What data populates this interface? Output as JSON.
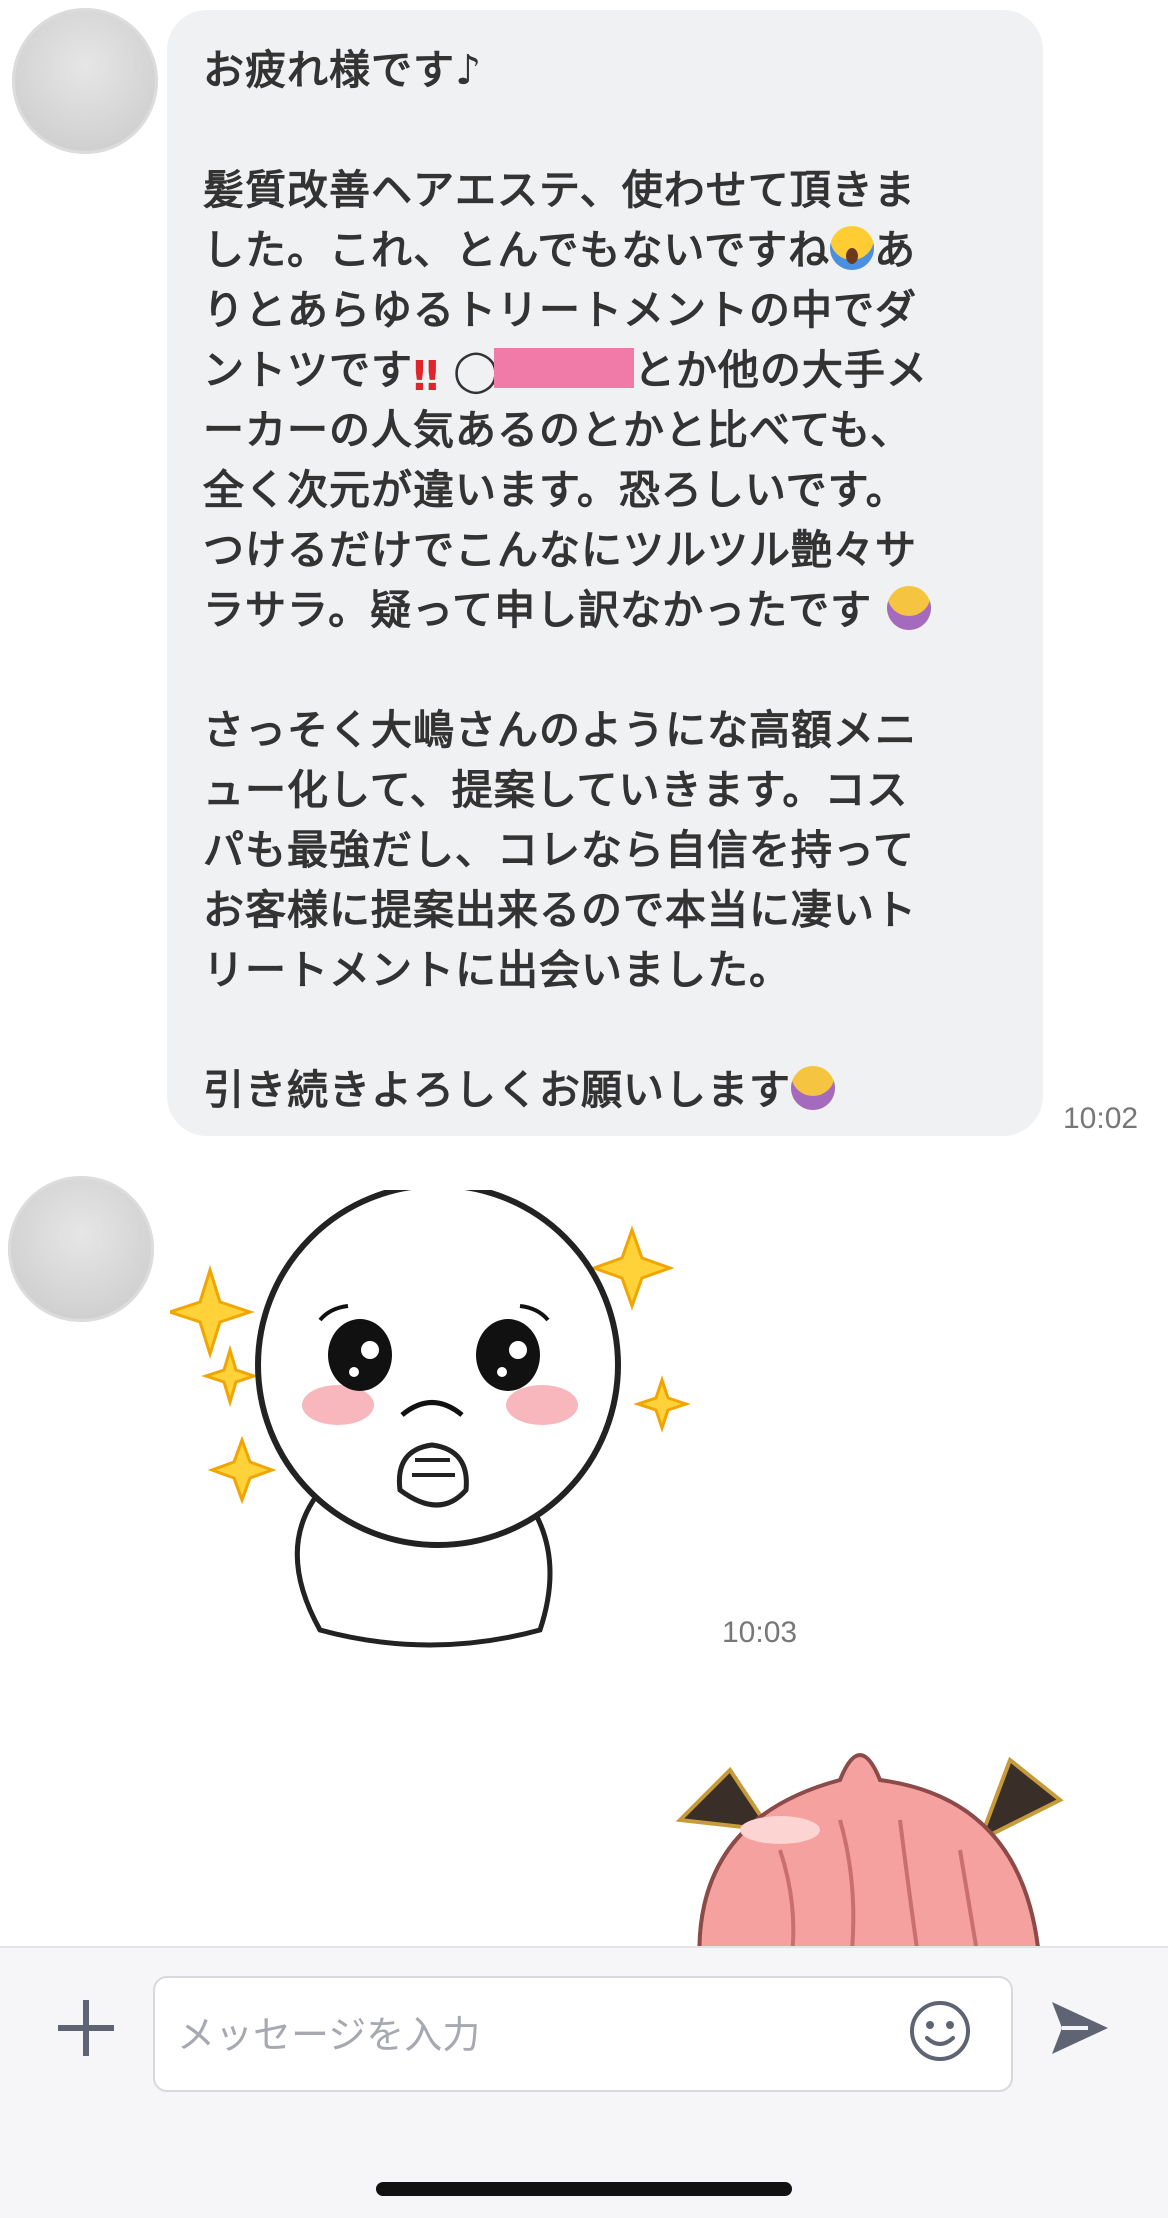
{
  "messages": [
    {
      "lines": [
        {
          "segments": [
            "お疲れ様です♪"
          ]
        },
        {
          "segments": [
            ""
          ]
        },
        {
          "segments": [
            "髪質改善ヘアエステ、使わせて頂きま"
          ]
        },
        {
          "segments": [
            "した。これ、とんでもないですね",
            "あ"
          ]
        },
        {
          "segments": [
            "りとあらゆるトリートメントの中でダ"
          ]
        },
        {
          "segments": [
            "ントツです",
            "◯",
            "とか他の大手メ"
          ]
        },
        {
          "segments": [
            "ーカーの人気あるのとかと比べても、"
          ]
        },
        {
          "segments": [
            "全く次元が違います。恐ろしいです。"
          ]
        },
        {
          "segments": [
            "つけるだけでこんなにツルツル艶々サ"
          ]
        },
        {
          "segments": [
            "ラサラ。疑って申し訳なかったです"
          ]
        },
        {
          "segments": [
            ""
          ]
        },
        {
          "segments": [
            "さっそく大嶋さんのようにな高額メニ"
          ]
        },
        {
          "segments": [
            "ュー化して、提案していきます。コス"
          ]
        },
        {
          "segments": [
            "パも最強だし、コレなら自信を持って"
          ]
        },
        {
          "segments": [
            "お客様に提案出来るので本当に凄いト"
          ]
        },
        {
          "segments": [
            "リートメントに出会いました。"
          ]
        },
        {
          "segments": [
            ""
          ]
        },
        {
          "segments": [
            "引き続きよろしくお願いします"
          ]
        }
      ],
      "time": "10:02"
    },
    {
      "sticker": "praying-moon-sticker",
      "time": "10:03"
    },
    {
      "sticker": "pink-hair-character-sticker"
    }
  ],
  "emoji": {
    "scream": "face-screaming-icon",
    "bang": "‼",
    "bow": "person-bowing-icon"
  },
  "redaction_color": "#f07ba8",
  "input_bar": {
    "placeholder": "メッセージを入力",
    "value": ""
  }
}
